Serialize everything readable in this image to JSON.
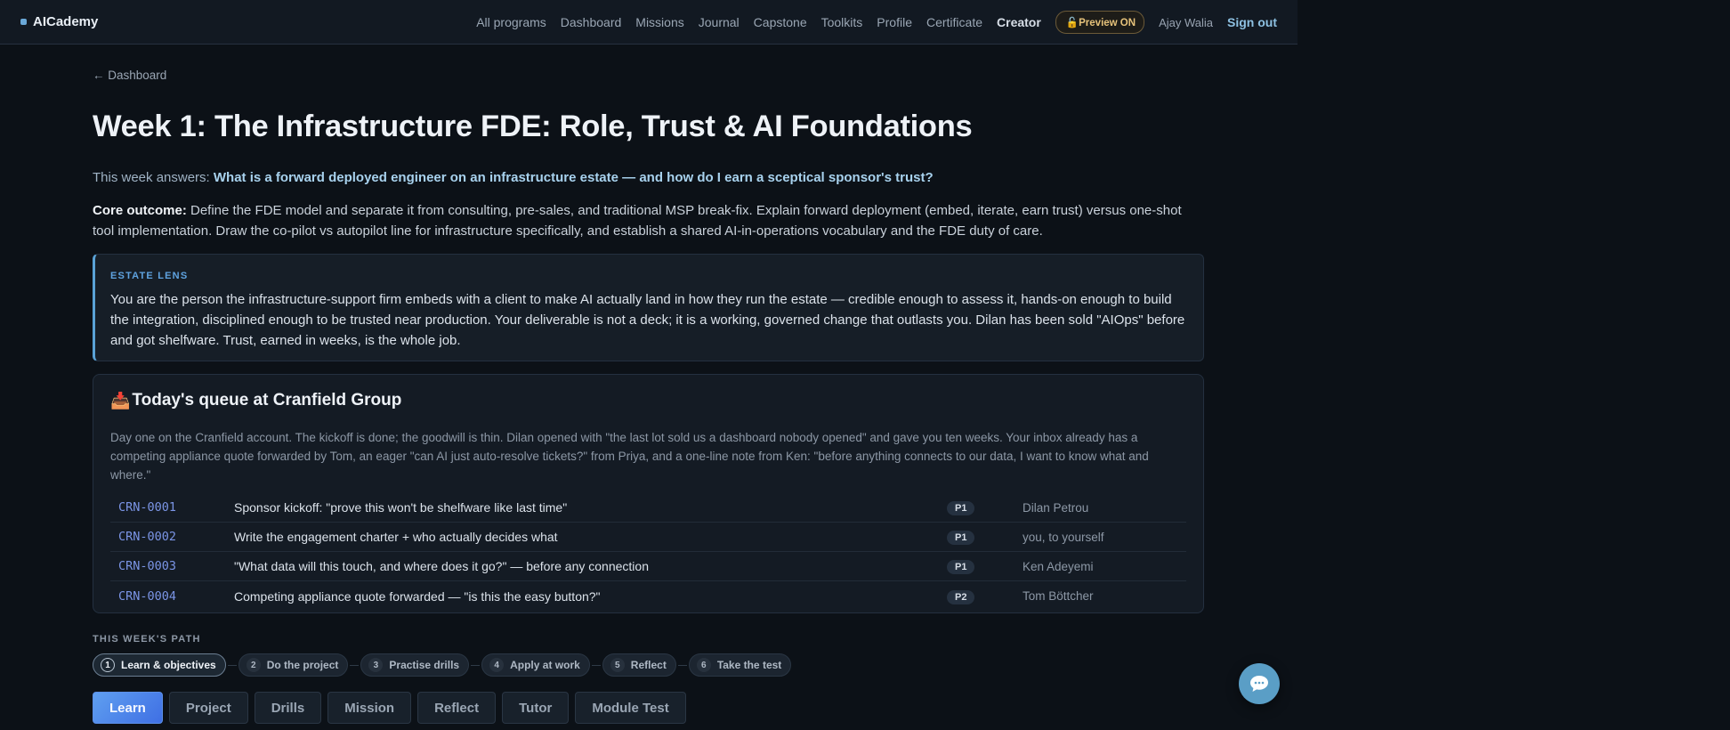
{
  "nav": {
    "brand": "AICademy",
    "links": [
      "All programs",
      "Dashboard",
      "Missions",
      "Journal",
      "Capstone",
      "Toolkits",
      "Profile",
      "Certificate"
    ],
    "creator": "Creator",
    "preview": "🔓Preview ON",
    "user": "Ajay Walia",
    "signout": "Sign out"
  },
  "back_link": "← Dashboard",
  "page": {
    "title": "Week 1: The Infrastructure FDE: Role, Trust & AI Foundations",
    "answers_prefix": "This week answers: ",
    "answers_question": "What is a forward deployed engineer on an infrastructure estate — and how do I earn a sceptical sponsor's trust?",
    "outcome_label": "Core outcome:",
    "outcome_text": " Define the FDE model and separate it from consulting, pre-sales, and traditional MSP break-fix. Explain forward deployment (embed, iterate, earn trust) versus one-shot tool implementation. Draw the co-pilot vs autopilot line for infrastructure specifically, and establish a shared AI-in-operations vocabulary and the FDE duty of care."
  },
  "lens": {
    "kicker": "ESTATE LENS",
    "text": "You are the person the infrastructure-support firm embeds with a client to make AI actually land in how they run the estate — credible enough to assess it, hands-on enough to build the integration, disciplined enough to be trusted near production. Your deliverable is not a deck; it is a working, governed change that outlasts you. Dilan has been sold \"AIOps\" before and got shelfware. Trust, earned in weeks, is the whole job."
  },
  "queue": {
    "icon": "📥",
    "title": "Today's queue at Cranfield Group",
    "intro": "Day one on the Cranfield account. The kickoff is done; the goodwill is thin. Dilan opened with \"the last lot sold us a dashboard nobody opened\" and gave you ten weeks. Your inbox already has a competing appliance quote forwarded by Tom, an eager \"can AI just auto-resolve tickets?\" from Priya, and a one-line note from Ken: \"before anything connects to our data, I want to know what and where.\"",
    "rows": [
      {
        "id": "CRN-0001",
        "title": "Sponsor kickoff: \"prove this won't be shelfware like last time\"",
        "priority": "P1",
        "owner": "Dilan Petrou"
      },
      {
        "id": "CRN-0002",
        "title": "Write the engagement charter + who actually decides what",
        "priority": "P1",
        "owner": "you, to yourself"
      },
      {
        "id": "CRN-0003",
        "title": "\"What data will this touch, and where does it go?\" — before any connection",
        "priority": "P1",
        "owner": "Ken Adeyemi"
      },
      {
        "id": "CRN-0004",
        "title": "Competing appliance quote forwarded — \"is this the easy button?\"",
        "priority": "P2",
        "owner": "Tom Böttcher"
      }
    ]
  },
  "path": {
    "label": "THIS WEEK'S PATH",
    "steps": [
      {
        "n": "1",
        "label": "Learn & objectives"
      },
      {
        "n": "2",
        "label": "Do the project"
      },
      {
        "n": "3",
        "label": "Practise drills"
      },
      {
        "n": "4",
        "label": "Apply at work"
      },
      {
        "n": "5",
        "label": "Reflect"
      },
      {
        "n": "6",
        "label": "Take the test"
      }
    ]
  },
  "tabs": [
    "Learn",
    "Project",
    "Drills",
    "Mission",
    "Reflect",
    "Tutor",
    "Module Test"
  ],
  "colors": {
    "accent": "#5aa2d6",
    "active_tab_start": "#5f9ff0",
    "active_tab_end": "#3f6fe4",
    "ticket_id": "#7b95e6",
    "preview_badge": "#e6c27a"
  },
  "icons": {
    "brand": "square-dot-icon",
    "queue": "inbox-tray-icon",
    "chat": "chat-bubble-icon"
  }
}
